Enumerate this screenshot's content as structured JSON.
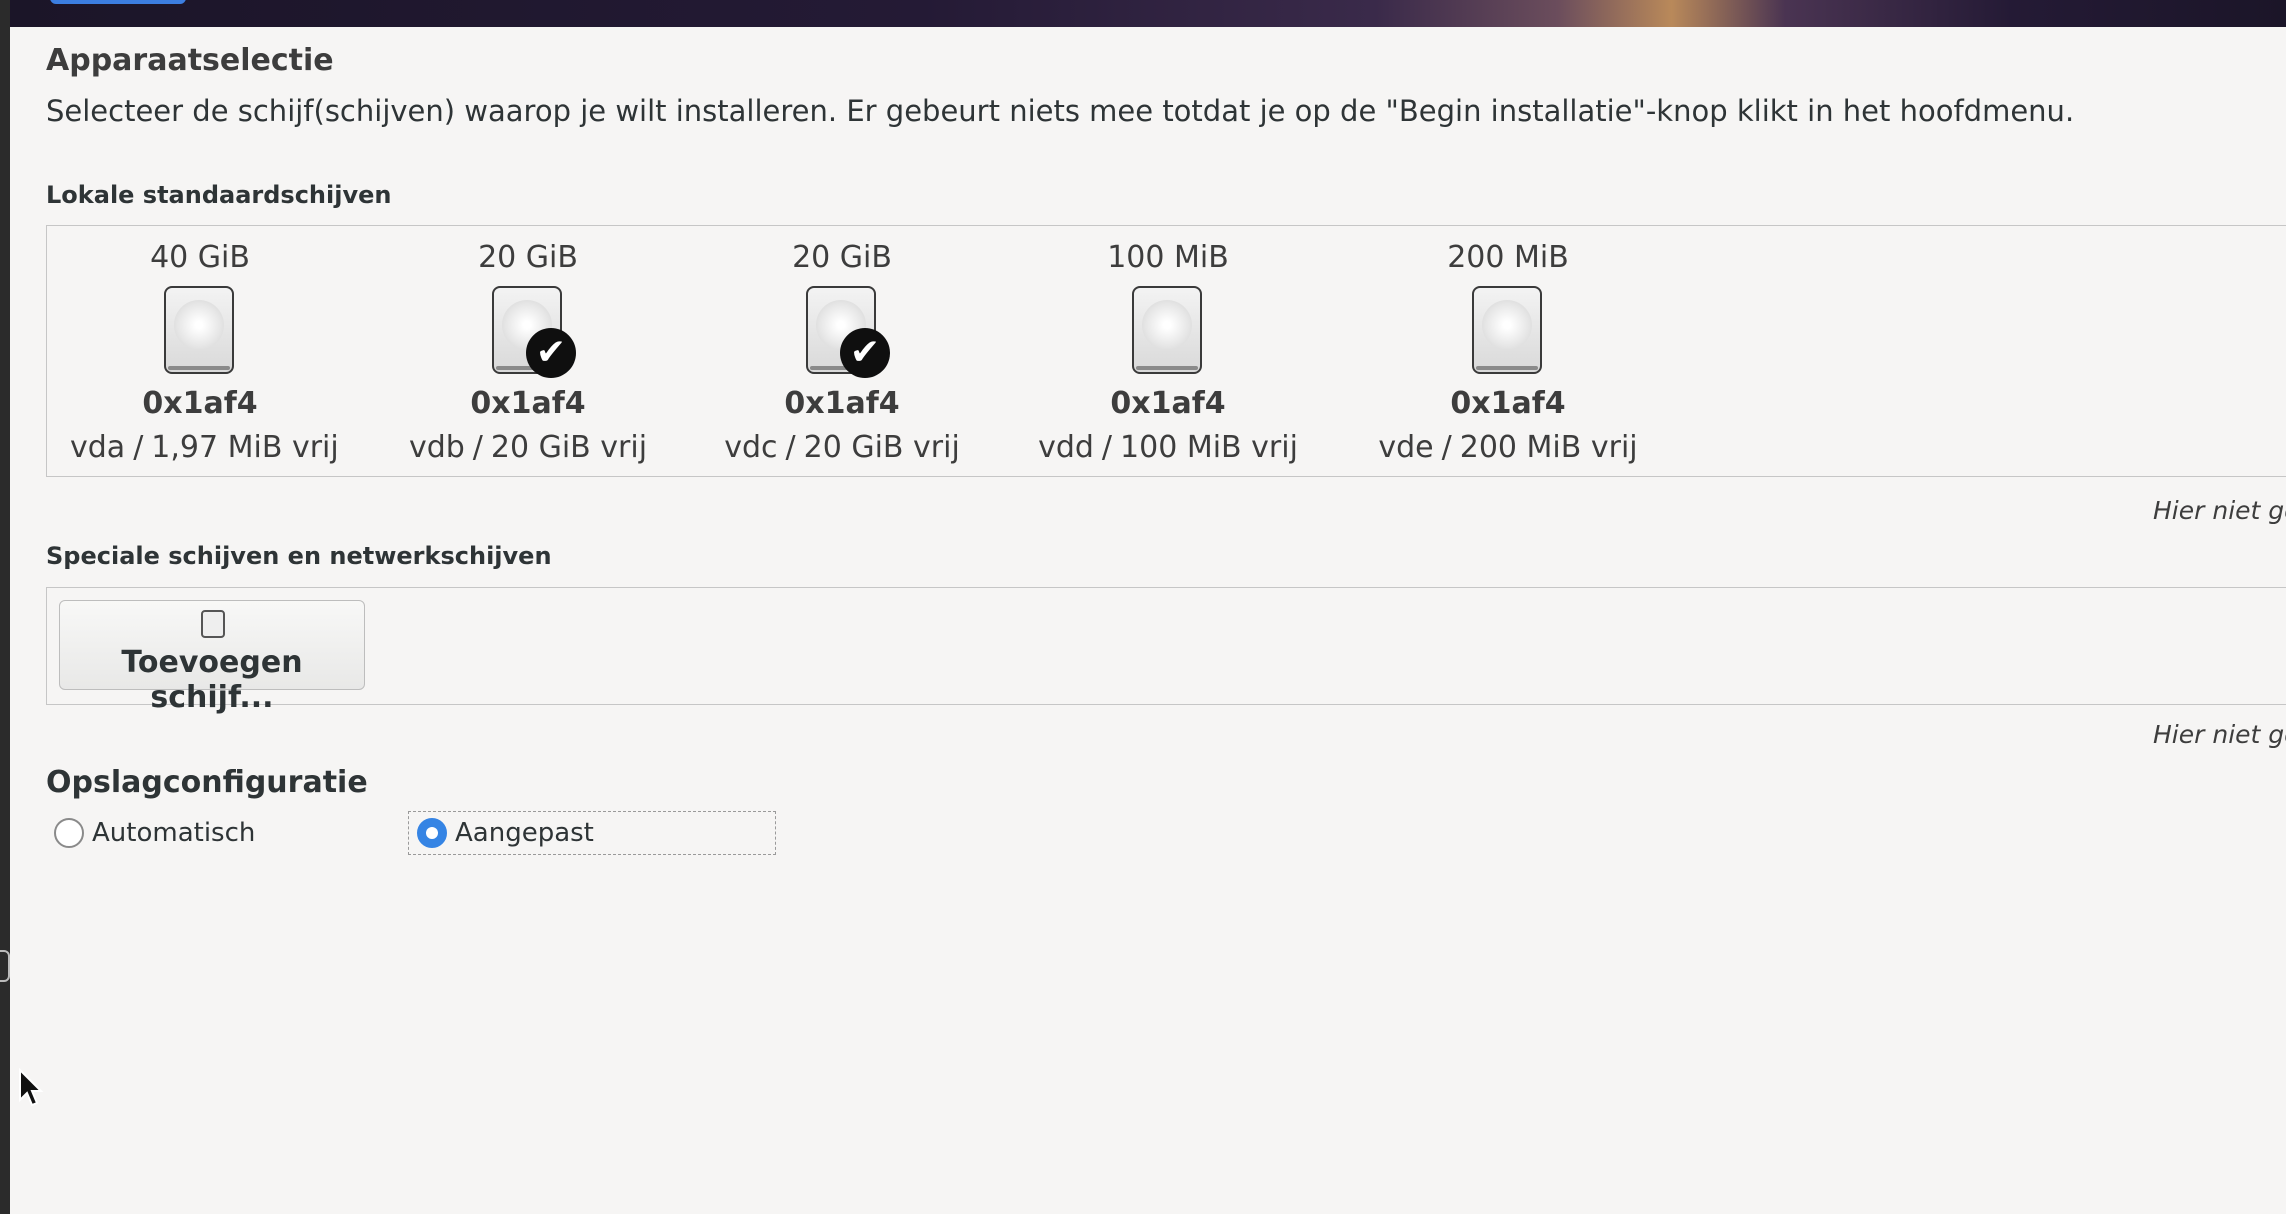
{
  "page": {
    "title": "Apparaatselectie",
    "description": "Selecteer de schijf(schijven) waarop je wilt installeren.  Er gebeurt niets mee totdat je op de \"Begin installatie\"-knop klikt in het hoofdmenu."
  },
  "local_disks": {
    "label": "Lokale standaardschijven",
    "not_here_note": "Hier niet ge",
    "disks": [
      {
        "size": "40 GiB",
        "model": "0x1af4",
        "device": "vda",
        "free": "1,97 MiB vrij",
        "selected": false
      },
      {
        "size": "20 GiB",
        "model": "0x1af4",
        "device": "vdb",
        "free": "20 GiB vrij",
        "selected": true
      },
      {
        "size": "20 GiB",
        "model": "0x1af4",
        "device": "vdc",
        "free": "20 GiB vrij",
        "selected": true
      },
      {
        "size": "100 MiB",
        "model": "0x1af4",
        "device": "vdd",
        "free": "100 MiB vrij",
        "selected": false
      },
      {
        "size": "200 MiB",
        "model": "0x1af4",
        "device": "vde",
        "free": "200 MiB vrij",
        "selected": false
      }
    ],
    "separator": "/"
  },
  "special_disks": {
    "label": "Speciale schijven en netwerkschijven",
    "add_button_label": "Toevoegen schijf...",
    "not_here_note": "Hier niet ge"
  },
  "storage": {
    "title": "Opslagconfiguratie",
    "options": [
      {
        "label": "Automatisch",
        "checked": false
      },
      {
        "label": "Aangepast",
        "checked": true
      }
    ]
  },
  "icons": {
    "disk": "hard-disk-icon",
    "check": "checkmark-icon",
    "cursor": "mouse-pointer-icon"
  },
  "colors": {
    "accent": "#3584e4",
    "background": "#f6f5f4"
  }
}
